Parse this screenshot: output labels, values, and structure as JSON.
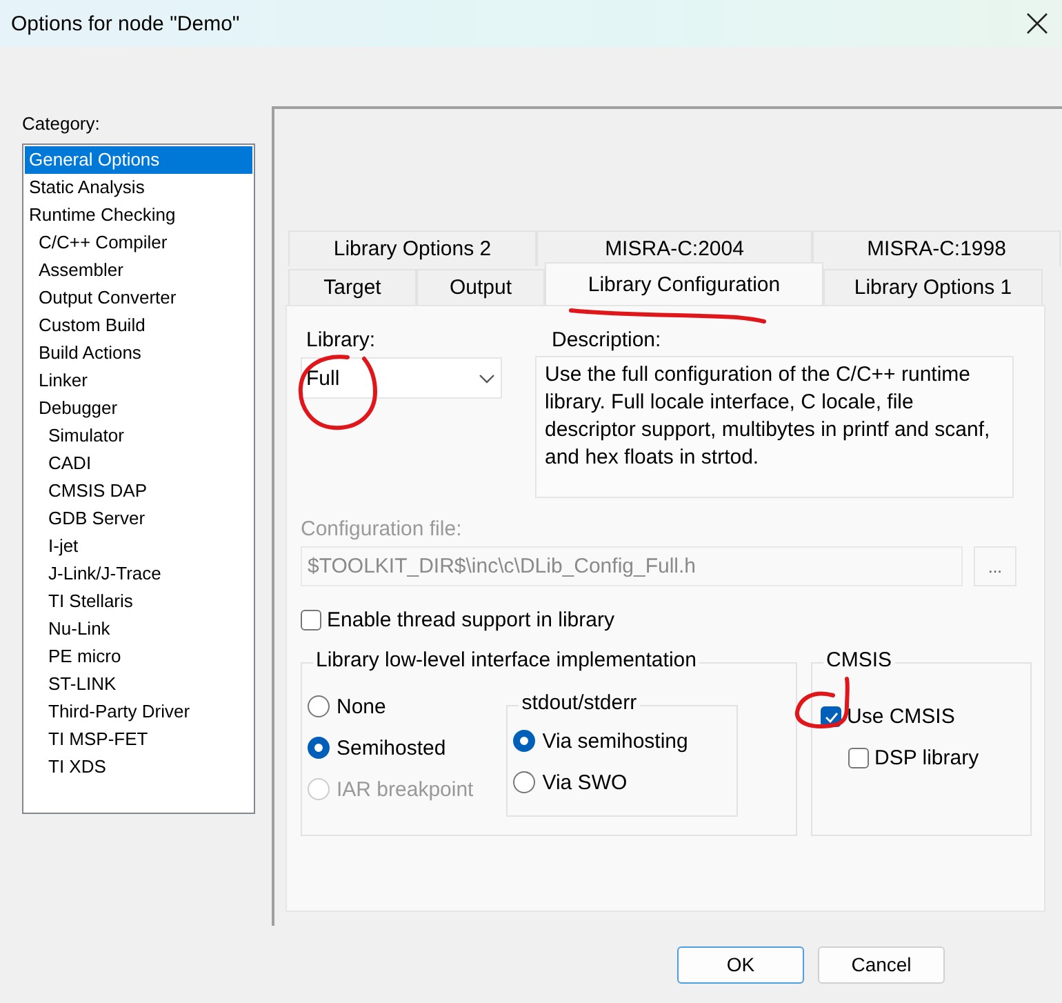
{
  "window": {
    "title": "Options for node \"Demo\""
  },
  "category": {
    "label": "Category:",
    "items": [
      {
        "label": "General Options",
        "selected": true
      },
      {
        "label": "Static Analysis",
        "selected": false
      },
      {
        "label": "Runtime Checking",
        "selected": false,
        "children": [
          {
            "label": "C/C++ Compiler",
            "selected": false
          },
          {
            "label": "Assembler",
            "selected": false
          },
          {
            "label": "Output Converter",
            "selected": false
          },
          {
            "label": "Custom Build",
            "selected": false
          },
          {
            "label": "Build Actions",
            "selected": false
          },
          {
            "label": "Linker",
            "selected": false
          },
          {
            "label": "Debugger",
            "selected": false,
            "children": [
              {
                "label": "Simulator",
                "selected": false
              },
              {
                "label": "CADI",
                "selected": false
              },
              {
                "label": "CMSIS DAP",
                "selected": false
              },
              {
                "label": "GDB Server",
                "selected": false
              },
              {
                "label": "I-jet",
                "selected": false
              },
              {
                "label": "J-Link/J-Trace",
                "selected": false
              },
              {
                "label": "TI Stellaris",
                "selected": false
              },
              {
                "label": "Nu-Link",
                "selected": false
              },
              {
                "label": "PE micro",
                "selected": false
              },
              {
                "label": "ST-LINK",
                "selected": false
              },
              {
                "label": "Third-Party Driver",
                "selected": false
              },
              {
                "label": "TI MSP-FET",
                "selected": false
              },
              {
                "label": "TI XDS",
                "selected": false
              }
            ]
          }
        ]
      }
    ]
  },
  "tab_rows": [
    [
      {
        "label": "Library Options 2",
        "selected": false
      },
      {
        "label": "MISRA-C:2004",
        "selected": false
      },
      {
        "label": "MISRA-C:1998",
        "selected": false
      }
    ],
    [
      {
        "label": "Target",
        "selected": false
      },
      {
        "label": "Output",
        "selected": false
      },
      {
        "label": "Library Configuration",
        "selected": true
      },
      {
        "label": "Library Options 1",
        "selected": false
      }
    ]
  ],
  "library": {
    "label": "Library:",
    "value": "Full"
  },
  "description": {
    "label": "Description:",
    "text": "Use the full configuration of the C/C++ runtime library. Full locale interface, C locale, file descriptor support, multibytes in printf and scanf, and hex floats in strtod."
  },
  "config_file": {
    "label": "Configuration file:",
    "value": "$TOOLKIT_DIR$\\inc\\c\\DLib_Config_Full.h",
    "disabled": true,
    "browse": "..."
  },
  "thread_support": {
    "label": "Enable thread support in library",
    "checked": false
  },
  "low_level": {
    "title": "Library low-level interface implementation",
    "options": [
      {
        "label": "None",
        "selected": false,
        "disabled": false
      },
      {
        "label": "Semihosted",
        "selected": true,
        "disabled": false
      },
      {
        "label": "IAR breakpoint",
        "selected": false,
        "disabled": true
      }
    ]
  },
  "stdout": {
    "title": "stdout/stderr",
    "options": [
      {
        "label": "Via semihosting",
        "selected": true,
        "disabled": false
      },
      {
        "label": "Via SWO",
        "selected": false,
        "disabled": false
      }
    ]
  },
  "cmsis": {
    "title": "CMSIS",
    "items": [
      {
        "label": "Use CMSIS",
        "checked": true
      },
      {
        "label": "DSP library",
        "checked": false
      }
    ]
  },
  "buttons": [
    {
      "label": "OK",
      "default": true
    },
    {
      "label": "Cancel",
      "default": false
    }
  ]
}
